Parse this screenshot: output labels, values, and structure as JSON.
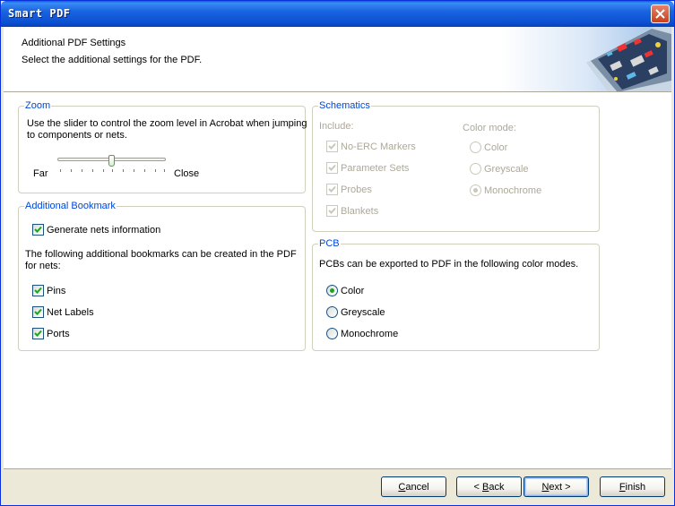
{
  "window": {
    "title": "Smart PDF"
  },
  "header": {
    "title": "Additional PDF Settings",
    "subtitle": "Select the additional settings for the PDF."
  },
  "zoom": {
    "legend": "Zoom",
    "description_line1": "Use the slider to control the zoom level in Acrobat when jumping",
    "description_line2": "to components or nets.",
    "far_label": "Far",
    "close_label": "Close",
    "slider_position": 0.5
  },
  "bookmark": {
    "legend": "Additional Bookmark",
    "generate_nets_label": "Generate nets information",
    "description_line1": "The following additional bookmarks can be created in the PDF",
    "description_line2": "for nets:",
    "items": [
      {
        "label": "Pins",
        "checked": true
      },
      {
        "label": "Net Labels",
        "checked": true
      },
      {
        "label": "Ports",
        "checked": true
      }
    ]
  },
  "schematics": {
    "legend": "Schematics",
    "include_label": "Include:",
    "include_items": [
      {
        "label": "No-ERC Markers",
        "checked": true
      },
      {
        "label": "Parameter Sets",
        "checked": true
      },
      {
        "label": "Probes",
        "checked": true
      },
      {
        "label": "Blankets",
        "checked": true
      }
    ],
    "color_mode_label": "Color mode:",
    "color_modes": [
      {
        "label": "Color",
        "selected": false
      },
      {
        "label": "Greyscale",
        "selected": false
      },
      {
        "label": "Monochrome",
        "selected": true
      }
    ]
  },
  "pcb": {
    "legend": "PCB",
    "description": "PCBs can be exported to PDF in the following color modes.",
    "color_modes": [
      {
        "label": "Color",
        "selected": true
      },
      {
        "label": "Greyscale",
        "selected": false
      },
      {
        "label": "Monochrome",
        "selected": false
      }
    ]
  },
  "footer": {
    "cancel": {
      "mnemonic": "C",
      "rest": "ancel"
    },
    "back": {
      "prefix": "< ",
      "mnemonic": "B",
      "rest": "ack"
    },
    "next": {
      "mnemonic": "N",
      "rest": "ext >"
    },
    "finish": {
      "mnemonic": "F",
      "rest": "inish"
    }
  },
  "colors": {
    "title_bar": "#0b4fd0",
    "legend_text": "#0046d5",
    "check_mark": "#21a121",
    "disabled_text": "#aca899"
  }
}
